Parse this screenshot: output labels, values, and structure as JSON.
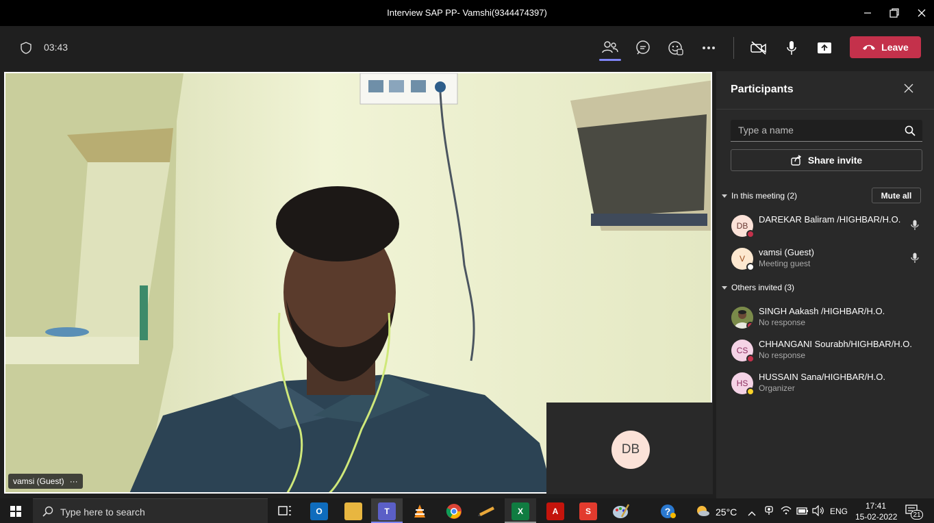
{
  "window": {
    "title": "Interview SAP PP- Vamshi(9344474397)"
  },
  "toolbar": {
    "timer": "03:43",
    "leave_label": "Leave"
  },
  "video": {
    "name_tag": "vamsi (Guest)",
    "more": "···"
  },
  "self_view": {
    "initials": "DB"
  },
  "panel": {
    "title": "Participants",
    "search_placeholder": "Type a name",
    "share_invite": "Share invite",
    "in_meeting_label": "In this meeting (2)",
    "mute_all": "Mute all",
    "others_label": "Others invited (3)",
    "in_meeting": [
      {
        "initials": "DB",
        "name": "DAREKAR Baliram /HIGHBAR/H.O.",
        "sub": "",
        "status_color": "#c4314b"
      },
      {
        "initials": "V",
        "name": "vamsi (Guest)",
        "sub": "Meeting guest",
        "status_color": "#ffffff"
      }
    ],
    "others": [
      {
        "initials": "",
        "name": "SINGH Aakash /HIGHBAR/H.O.",
        "sub": "No response",
        "status_color": "#c4314b"
      },
      {
        "initials": "CS",
        "name": "CHHANGANI Sourabh/HIGHBAR/H.O.",
        "sub": "No response",
        "status_color": "#c4314b"
      },
      {
        "initials": "HS",
        "name": "HUSSAIN Sana/HIGHBAR/H.O.",
        "sub": "Organizer",
        "status_color": "#f8d22a"
      }
    ]
  },
  "taskbar": {
    "search_placeholder": "Type here to search",
    "temperature": "25°C",
    "language": "ENG",
    "time": "17:41",
    "date": "15-02-2022",
    "notifications": "21"
  },
  "colors": {
    "leave": "#c4314b",
    "accent": "#6264a7"
  }
}
